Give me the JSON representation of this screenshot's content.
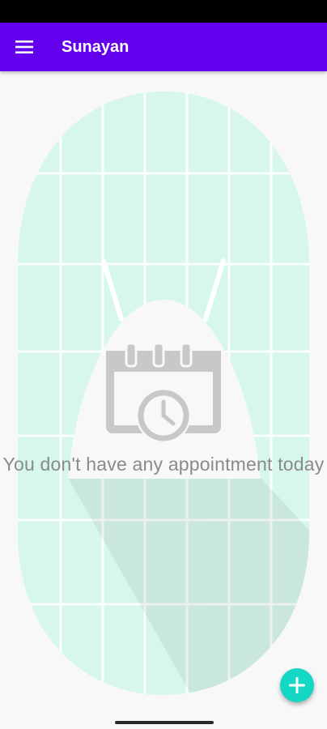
{
  "app_bar": {
    "title": "Sunayan",
    "menu_icon": "hamburger-menu-icon",
    "background": "#6200ee"
  },
  "empty_state": {
    "illustration_icon": "calendar-clock-icon",
    "message": "You don't have any appointment today"
  },
  "fab": {
    "icon": "plus-icon",
    "color": "#14d8c4"
  },
  "colors": {
    "illustration_bg": "#d6f7e9",
    "illustration_grid": "#ffffff",
    "icon_gray": "#c8c8c8"
  }
}
